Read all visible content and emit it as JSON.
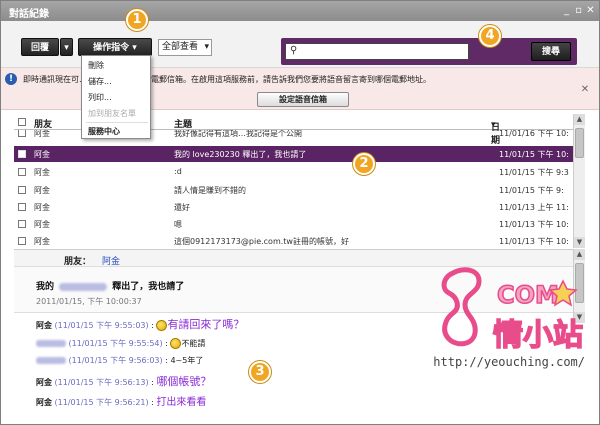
{
  "window": {
    "title": "對話紀錄",
    "controls": [
      "minimize",
      "restore",
      "close"
    ]
  },
  "toolbar": {
    "reply_label": "回覆",
    "actions_label": "操作指令",
    "view_select": "全部查看",
    "search_placeholder": "",
    "search_button": "搜尋"
  },
  "actions_menu": {
    "items": [
      {
        "label": "刪除",
        "enabled": true
      },
      {
        "label": "儲存...",
        "enabled": true
      },
      {
        "label": "列印...",
        "enabled": true
      },
      {
        "label": "加到朋友名單",
        "enabled": false
      },
      {
        "label": "服務中心",
        "enabled": true
      }
    ]
  },
  "notice": {
    "text": "即時通訊現在可…留言寄到您指定的電郵信箱。在啟用這項服務前，請告訴我們您要將語音留言寄到哪個電郵地址。",
    "button": "設定語音信箱"
  },
  "grid": {
    "headers": {
      "friend": "朋友",
      "subject": "主題",
      "date": "日期"
    },
    "rows": [
      {
        "friend": "阿金",
        "subject": "我好像記得有這項…我記得是个公開",
        "date": "11/01/16 下午 10:",
        "selected": false,
        "truncated": true
      },
      {
        "friend": "阿金",
        "subject": "我的 love230230 釋出了，我也請了",
        "date": "11/01/15 下午 10:",
        "selected": true
      },
      {
        "friend": "阿金",
        "subject": ":d",
        "date": "11/01/15 下午 9:3",
        "selected": false
      },
      {
        "friend": "阿金",
        "subject": "請人情是賺到不錯的",
        "date": "11/01/15 下午 9:",
        "selected": false
      },
      {
        "friend": "阿金",
        "subject": "還好",
        "date": "11/01/13 上午 11:",
        "selected": false
      },
      {
        "friend": "阿金",
        "subject": "嗯",
        "date": "11/01/13 下午 10:",
        "selected": false
      },
      {
        "friend": "阿金",
        "subject": "這個0912173173@pie.com.tw註冊的帳號，好",
        "date": "11/01/13 下午 10:",
        "selected": false
      }
    ]
  },
  "reading": {
    "friend_label": "朋友：",
    "friend_name": "阿金",
    "subject_prefix": "我的",
    "subject_suffix": "釋出了，我也請了",
    "timestamp": "2011/01/15, 下午 10:00:37",
    "messages": [
      {
        "who": "阿金",
        "time": "(11/01/15 下午 9:55:03)",
        "text": "有請回來了嗎？",
        "style": "big",
        "emoticon": true
      },
      {
        "who": "",
        "time": "(11/01/15 下午 9:55:54)",
        "text": "不能請",
        "style": "normal",
        "emoticon": true
      },
      {
        "who": "",
        "time": "(11/01/15 下午 9:56:03)",
        "text": "4~5年了",
        "style": "normal",
        "emoticon": false
      },
      {
        "who": "阿金",
        "time": "(11/01/15 下午 9:56:13)",
        "text": "哪個帳號？",
        "style": "big",
        "emoticon": false
      },
      {
        "who": "阿金",
        "time": "(11/01/15 下午 9:56:21)",
        "text": "打出來看看",
        "style": "big-red",
        "emoticon": false
      }
    ]
  },
  "callouts": [
    "1",
    "2",
    "3",
    "4"
  ],
  "watermark": {
    "url": "http://yeouching.com/"
  }
}
